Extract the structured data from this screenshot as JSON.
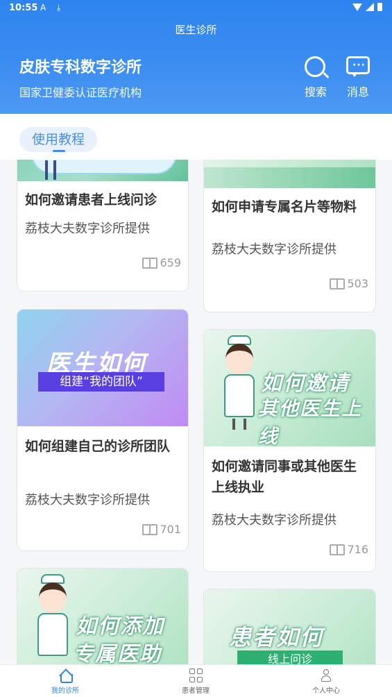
{
  "status_bar": {
    "time": "10:55",
    "notif_icons": "A ⤓"
  },
  "header": {
    "app_title": "医生诊所",
    "clinic_name": "皮肤专科数字诊所",
    "clinic_subtitle": "国家卫健委认证医疗机构",
    "search_label": "搜索",
    "message_label": "消息"
  },
  "tabs": {
    "active_label": "使用教程"
  },
  "cards": [
    {
      "title": "如何邀请患者上线问诊",
      "source": "荔枝大夫数字诊所提供",
      "views": "659",
      "thumb_text": ""
    },
    {
      "title": "如何申请专属名片等物料",
      "source": "荔枝大夫数字诊所提供",
      "views": "503",
      "thumb_text": ""
    },
    {
      "title": "如何组建自己的诊所团队",
      "source": "荔枝大夫数字诊所提供",
      "views": "701",
      "thumb_text": "医生如何",
      "thumb_sub": "组建“我的团队”"
    },
    {
      "title": "如何邀请同事或其他医生上线执业",
      "source": "荔枝大夫数字诊所提供",
      "views": "716",
      "thumb_text": "如何邀请",
      "thumb_text2": "其他医生上线"
    },
    {
      "title": "",
      "source": "",
      "views": "",
      "thumb_text": "如何添加",
      "thumb_text2": "专属医助"
    },
    {
      "title": "",
      "source": "",
      "views": "",
      "thumb_text": "患者如何",
      "thumb_sub": "线上问诊"
    }
  ],
  "bottom_nav": {
    "items": [
      {
        "label": "我的诊所",
        "icon": "home-icon",
        "active": true
      },
      {
        "label": "患者管理",
        "icon": "grid-icon",
        "active": false
      },
      {
        "label": "个人中心",
        "icon": "person-icon",
        "active": false
      }
    ]
  },
  "colors": {
    "primary": "#2e84ee",
    "tab_bg": "#e8f1fc",
    "banner_purple": "#5a3fe0",
    "banner_green": "#2fb072"
  }
}
